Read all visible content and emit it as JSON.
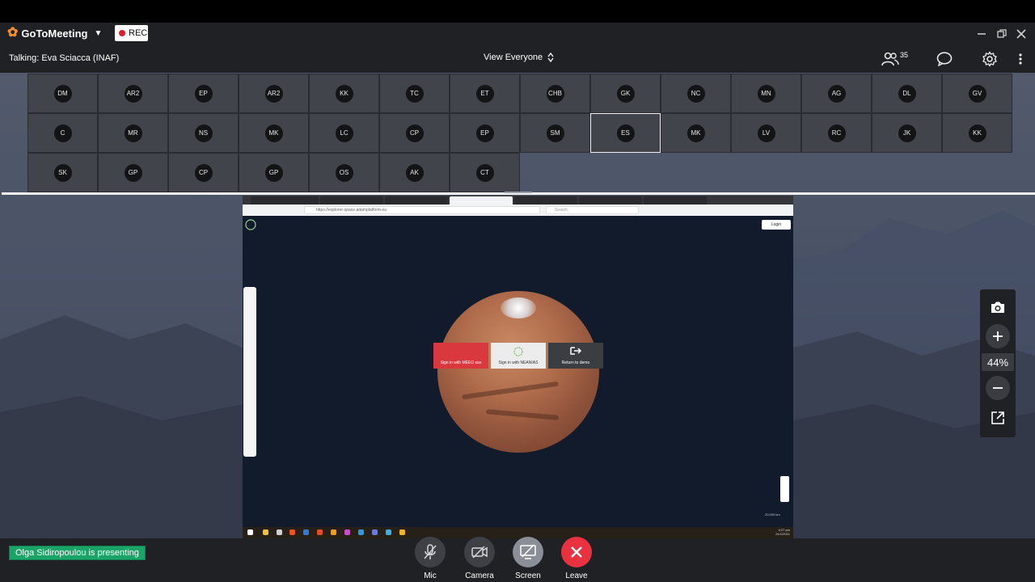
{
  "app": {
    "name": "GoToMeeting",
    "rec_label": "REC"
  },
  "infobar": {
    "talking": "Talking: Eva Sciacca (INAF)",
    "view_label": "View Everyone",
    "participants_count": "35"
  },
  "participants": [
    "DM",
    "AR2",
    "EP",
    "AR2",
    "KK",
    "TC",
    "ET",
    "CHB",
    "GK",
    "NC",
    "MN",
    "AG",
    "DL",
    "GV",
    "C",
    "MR",
    "NS",
    "MK",
    "LC",
    "CP",
    "EP",
    "SM",
    "ES",
    "MK",
    "LV",
    "RC",
    "JK",
    "KK",
    "SK",
    "GP",
    "CP",
    "GP",
    "OS",
    "AK",
    "CT"
  ],
  "active_participant_index": 22,
  "shared_screen": {
    "url": "https://explorer-space.adamplatform.eu",
    "search_placeholder": "Search",
    "login_label": "Login",
    "buttons": [
      {
        "label": "Sign in with MEEO sso",
        "color": "#d9383f"
      },
      {
        "label": "Sign in with NEANIAS",
        "color": "#ececec"
      },
      {
        "label": "Return to demo",
        "color": "#3a3d42"
      }
    ],
    "scale_label": "20,000 km",
    "clock_time": "4:27 pm",
    "clock_date": "21/1/2021"
  },
  "zoom": {
    "value": "44%"
  },
  "presenting": "Olga Sidiropoulou is presenting",
  "controls": {
    "mic": "Mic",
    "camera": "Camera",
    "screen": "Screen",
    "leave": "Leave"
  },
  "colors": {
    "leave": "#e8323f",
    "presenting_badge": "#1aa566",
    "logo_accent": "#f68d2e"
  }
}
